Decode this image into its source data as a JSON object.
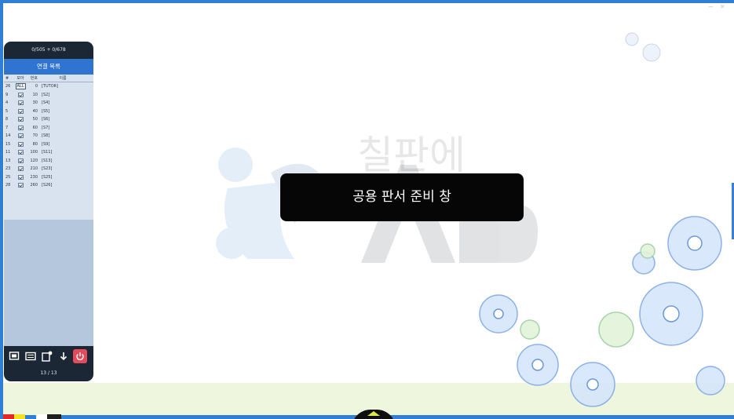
{
  "panel": {
    "header": "0/505 + 0/678",
    "title": "연결 목록",
    "columns": [
      "#",
      "모아",
      "번호",
      "이름"
    ],
    "all_label": "ALL",
    "rows": [
      {
        "idx": "26",
        "num": "0",
        "name": "[TUTOR]"
      },
      {
        "idx": "9",
        "num": "10",
        "name": "[S2]"
      },
      {
        "idx": "4",
        "num": "30",
        "name": "[S4]"
      },
      {
        "idx": "5",
        "num": "40",
        "name": "[S5]"
      },
      {
        "idx": "8",
        "num": "50",
        "name": "[S6]"
      },
      {
        "idx": "7",
        "num": "60",
        "name": "[S7]"
      },
      {
        "idx": "14",
        "num": "70",
        "name": "[S8]"
      },
      {
        "idx": "15",
        "num": "80",
        "name": "[S9]"
      },
      {
        "idx": "11",
        "num": "100",
        "name": "[S11]"
      },
      {
        "idx": "13",
        "num": "120",
        "name": "[S13]"
      },
      {
        "idx": "23",
        "num": "210",
        "name": "[S23]"
      },
      {
        "idx": "25",
        "num": "230",
        "name": "[S25]"
      },
      {
        "idx": "28",
        "num": "260",
        "name": "[S26]"
      }
    ],
    "pager": "13 / 13"
  },
  "watermark": "칠판에",
  "dialog": {
    "message": "공용 판서 준비 창"
  },
  "window_controls": "—  ×",
  "colors": {
    "accent": "#2f7fd6",
    "panel_dark": "#1c2735",
    "panel_bg": "#b4c7dc",
    "power": "#e34b5a",
    "dialog": "#060606"
  },
  "icons": [
    "screen-icon",
    "board-icon",
    "board-settings-icon",
    "download-arrow-icon",
    "power-icon"
  ]
}
